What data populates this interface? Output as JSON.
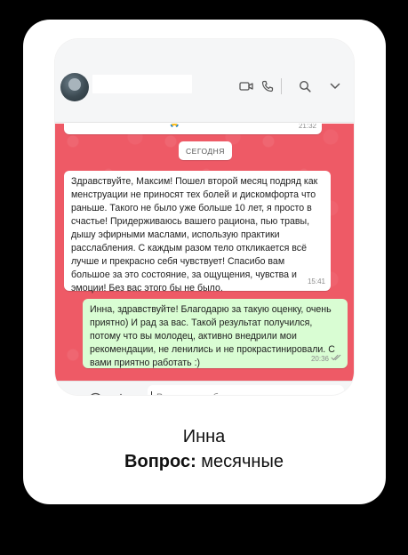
{
  "chat": {
    "previous_message": {
      "text": "...",
      "time": "21:32",
      "emoji": "🙏"
    },
    "date_divider": "СЕГОДНЯ",
    "messages": [
      {
        "direction": "incoming",
        "text": "Здравствуйте, Максим! Пошел второй месяц подряд как\nменструации не приносят тех болей и дискомфорта что\nраньше. Такого не было уже больше 10 лет, я просто в\nсчастье! Придерживаюсь вашего рациона, пью травы,\nдышу эфирными маслами, использую практики\nрасслабления. С каждым разом тело откликается всё\nлучше и прекрасно себя чувствует! Спасибо вам\nбольшое за это состояние, за ощущения, чувства и\nэмоции! Без вас этого бы не было.",
        "time": "15:41"
      },
      {
        "direction": "outgoing",
        "text": "Инна, здравствуйте! Благодарю за такую оценку, очень\nприятно) И рад за вас. Такой результат получился,\nпотому что вы молодец, активно внедрили мои\nрекомендации, не ленились и не прокрастинировали. С\nвами приятно работать :)",
        "time": "20:36",
        "status": "read"
      }
    ]
  },
  "composer": {
    "placeholder": "Введите сообщение"
  },
  "caption": {
    "name": "Инна",
    "question_label": "Вопрос:",
    "question_value": "месячные"
  },
  "colors": {
    "chat_bg": "#ee5a66",
    "outgoing_bubble": "#d9fdd3",
    "incoming_bubble": "#ffffff"
  },
  "icons": [
    "video-call-icon",
    "phone-icon",
    "search-icon",
    "chevron-down-icon",
    "emoji-icon",
    "plus-icon",
    "microphone-icon",
    "double-check-icon"
  ]
}
